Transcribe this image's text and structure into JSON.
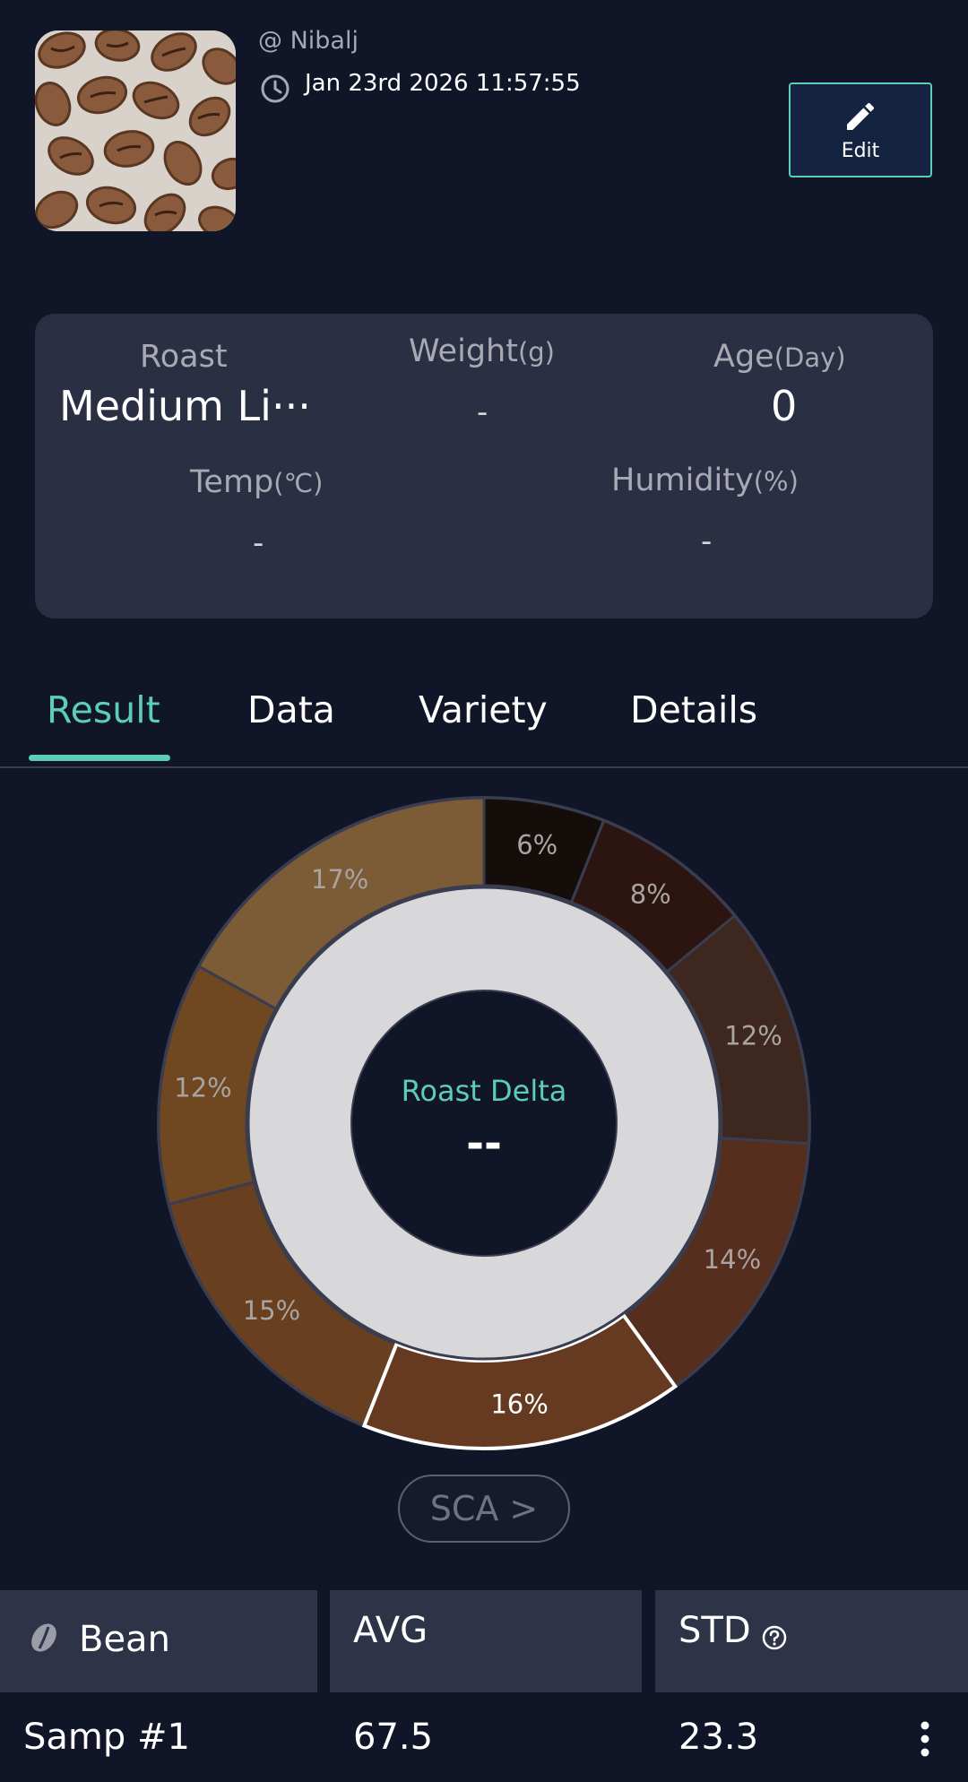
{
  "header": {
    "username": "@ Nibalj",
    "timestamp": "Jan 23rd 2026 11:57:55",
    "edit_label": "Edit",
    "image_name": "coffee-beans-photo"
  },
  "info": {
    "roast_label": "Roast",
    "roast_value": "Medium Li···",
    "weight_label": "Weight",
    "weight_unit": "(g)",
    "weight_value": "-",
    "age_label": "Age",
    "age_unit": "(Day)",
    "age_value": "0",
    "temp_label": "Temp",
    "temp_unit": "(℃)",
    "temp_value": "-",
    "humidity_label": "Humidity",
    "humidity_unit": "(%)",
    "humidity_value": "-"
  },
  "tabs": [
    {
      "label": "Result",
      "active": true
    },
    {
      "label": "Data",
      "active": false
    },
    {
      "label": "Variety",
      "active": false
    },
    {
      "label": "Details",
      "active": false
    }
  ],
  "chart_data": {
    "type": "pie",
    "center_label": "Roast Delta",
    "center_value": "--",
    "segments": [
      {
        "label": "6%",
        "value": 6,
        "color": "#150d0a"
      },
      {
        "label": "8%",
        "value": 8,
        "color": "#2c1410"
      },
      {
        "label": "12%",
        "value": 12,
        "color": "#3d271e"
      },
      {
        "label": "14%",
        "value": 14,
        "color": "#552e1e"
      },
      {
        "label": "16%",
        "value": 16,
        "color": "#653a21",
        "selected": true
      },
      {
        "label": "15%",
        "value": 15,
        "color": "#683f1f"
      },
      {
        "label": "12%",
        "value": 12,
        "color": "#6f4822"
      },
      {
        "label": "17%",
        "value": 17,
        "color": "#7c5b37"
      }
    ]
  },
  "sca_label": "SCA >",
  "table": {
    "headers": [
      "Bean",
      "AVG",
      "STD"
    ],
    "rows": [
      {
        "name": "Samp #1",
        "avg": "67.5",
        "std": "23.3"
      }
    ]
  },
  "colors": {
    "accent": "#5ccdb8",
    "background": "#111528",
    "card": "#2b2f43"
  }
}
